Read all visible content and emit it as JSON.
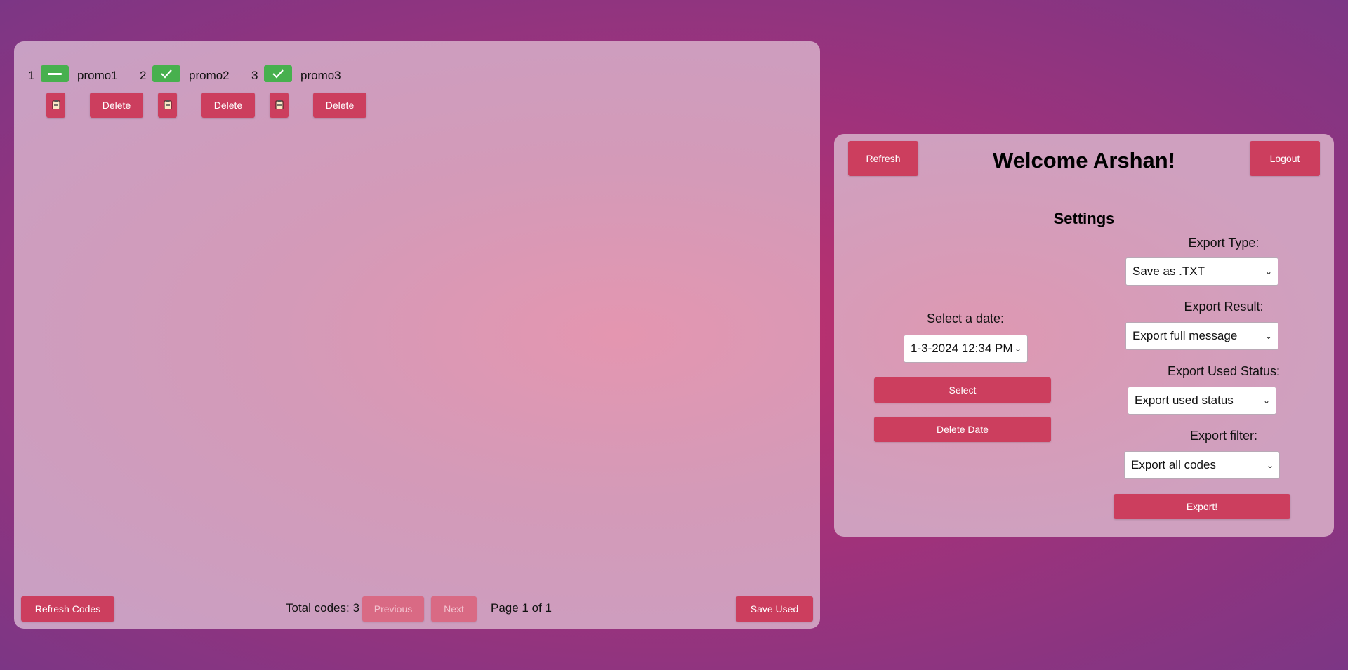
{
  "codes": [
    {
      "index": "1",
      "name": "promo1",
      "status": "unused",
      "delete_label": "Delete"
    },
    {
      "index": "2",
      "name": "promo2",
      "status": "used",
      "delete_label": "Delete"
    },
    {
      "index": "3",
      "name": "promo3",
      "status": "used",
      "delete_label": "Delete"
    }
  ],
  "codes_footer": {
    "refresh_label": "Refresh Codes",
    "total_label": "Total codes: 3",
    "previous_label": "Previous",
    "next_label": "Next",
    "page_label": "Page 1 of 1",
    "save_label": "Save Used"
  },
  "header": {
    "refresh_label": "Refresh",
    "welcome": "Welcome Arshan!",
    "logout_label": "Logout"
  },
  "settings": {
    "title": "Settings",
    "date_label": "Select a date:",
    "date_value": "1-3-2024 12:34 PM",
    "select_label": "Select",
    "delete_date_label": "Delete Date",
    "export_type_label": "Export Type:",
    "export_type_value": "Save as .TXT",
    "export_result_label": "Export Result:",
    "export_result_value": "Export full message",
    "export_used_label": "Export Used Status:",
    "export_used_value": "Export used status",
    "export_filter_label": "Export filter:",
    "export_filter_value": "Export all codes",
    "export_button_label": "Export!"
  },
  "colors": {
    "button": "#cc3e5e",
    "status_green": "#47b04e"
  }
}
